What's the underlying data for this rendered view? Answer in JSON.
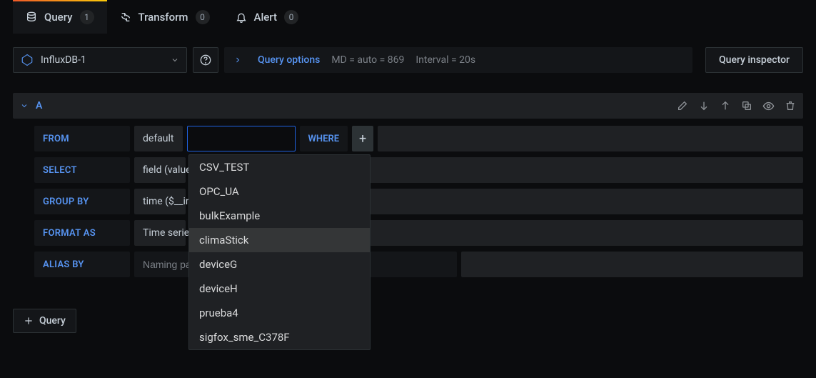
{
  "tabs": {
    "query": {
      "label": "Query",
      "badge": "1"
    },
    "transform": {
      "label": "Transform",
      "badge": "0"
    },
    "alert": {
      "label": "Alert",
      "badge": "0"
    }
  },
  "datasource": {
    "name": "InfluxDB-1"
  },
  "query_options": {
    "label": "Query options",
    "md_text": "MD = auto = 869",
    "interval_text": "Interval = 20s"
  },
  "inspector_label": "Query inspector",
  "query": {
    "ref_id": "A",
    "from_kw": "FROM",
    "from_policy": "default",
    "where_kw": "WHERE",
    "select_kw": "SELECT",
    "select_value": "field (value)",
    "groupby_kw": "GROUP BY",
    "groupby_value": "time ($__interval)",
    "format_kw": "FORMAT AS",
    "format_value": "Time series",
    "alias_kw": "ALIAS BY",
    "alias_placeholder": "Naming pattern"
  },
  "dropdown_items": [
    "CSV_TEST",
    "OPC_UA",
    "bulkExample",
    "climaStick",
    "deviceG",
    "deviceH",
    "prueba4",
    "sigfox_sme_C378F"
  ],
  "dropdown_hover_index": 3,
  "add_query_label": "Query"
}
